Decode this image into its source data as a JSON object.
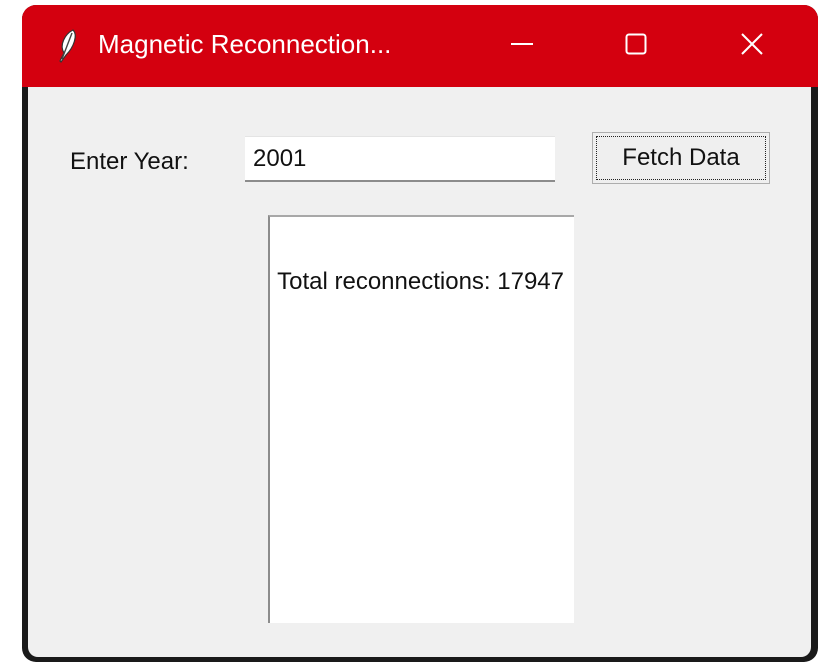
{
  "window": {
    "title": "Magnetic Reconnection...",
    "accent_color": "#d4000f",
    "icons": {
      "app": "feather-icon",
      "minimize": "minimize-icon",
      "maximize": "maximize-icon",
      "close": "close-icon"
    }
  },
  "form": {
    "year_label": "Enter Year:",
    "year_value": "2001",
    "fetch_label": "Fetch Data"
  },
  "result": {
    "text": "Total reconnections: 17947"
  }
}
